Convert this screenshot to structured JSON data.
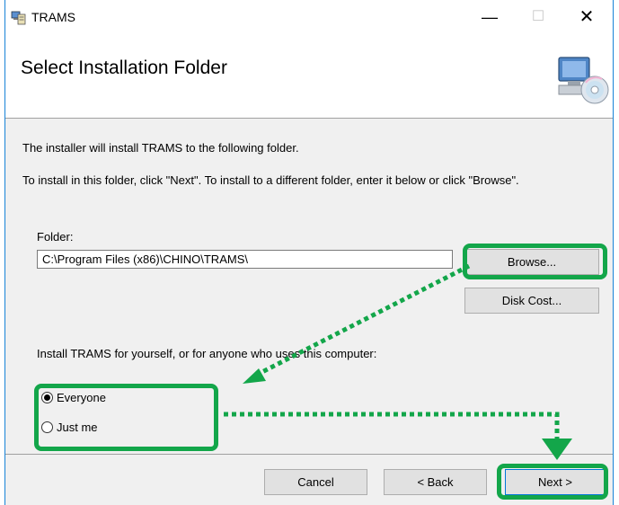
{
  "window": {
    "title": "TRAMS",
    "app_icon": "installer-icon",
    "minimize_glyph": "—",
    "maximize_glyph": "☐",
    "close_glyph": "✕"
  },
  "header": {
    "title": "Select Installation Folder",
    "graphic": "computer-cd-icon"
  },
  "body": {
    "intro": "The installer will install TRAMS to the following folder.",
    "instruction": "To install in this folder, click \"Next\". To install to a different folder, enter it below or click \"Browse\".",
    "folder_label": "Folder:",
    "folder_value": "C:\\Program Files (x86)\\CHINO\\TRAMS\\",
    "browse_label": "Browse...",
    "disk_cost_label": "Disk Cost...",
    "install_for_label": "Install TRAMS for yourself, or for anyone who uses this computer:",
    "options": [
      {
        "label": "Everyone",
        "selected": true
      },
      {
        "label": "Just me",
        "selected": false
      }
    ]
  },
  "footer": {
    "cancel_label": "Cancel",
    "back_label": "< Back",
    "next_label": "Next >"
  },
  "annotations": {
    "highlight_color": "#13a64a",
    "arrow_color": "#13a64a"
  }
}
